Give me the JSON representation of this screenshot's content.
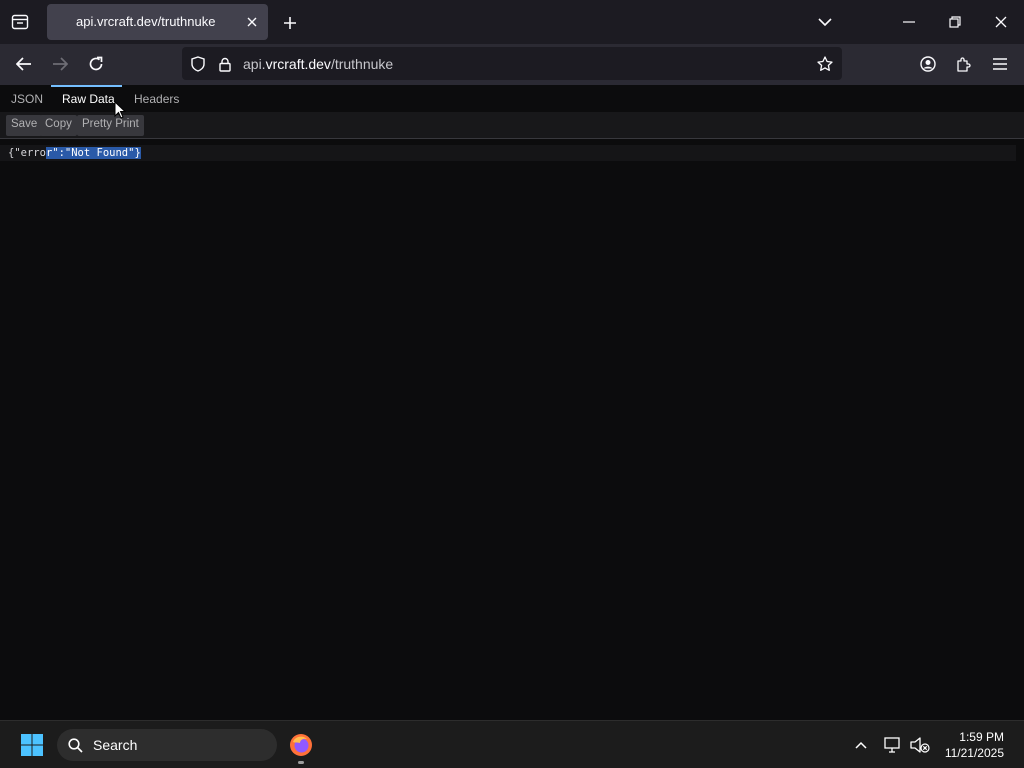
{
  "browser": {
    "tab": {
      "title": "api.vrcraft.dev/truthnuke"
    },
    "url": {
      "prefix": "api.",
      "host": "vrcraft.dev",
      "path": "/truthnuke"
    }
  },
  "viewer": {
    "tabs": [
      {
        "label": "JSON"
      },
      {
        "label": "Raw Data"
      },
      {
        "label": "Headers"
      }
    ],
    "active_tab": "Raw Data",
    "toolbar": {
      "save": "Save",
      "copy": "Copy",
      "pretty_print": "Pretty Print"
    },
    "raw": {
      "before": "{\"erro",
      "selected": "r\":\"Not Found\"}"
    }
  },
  "taskbar": {
    "search_label": "Search",
    "time": "1:59 PM",
    "date": "11/21/2025"
  },
  "colors": {
    "accent": "#75bfff",
    "selection": "#2a5aa8"
  }
}
